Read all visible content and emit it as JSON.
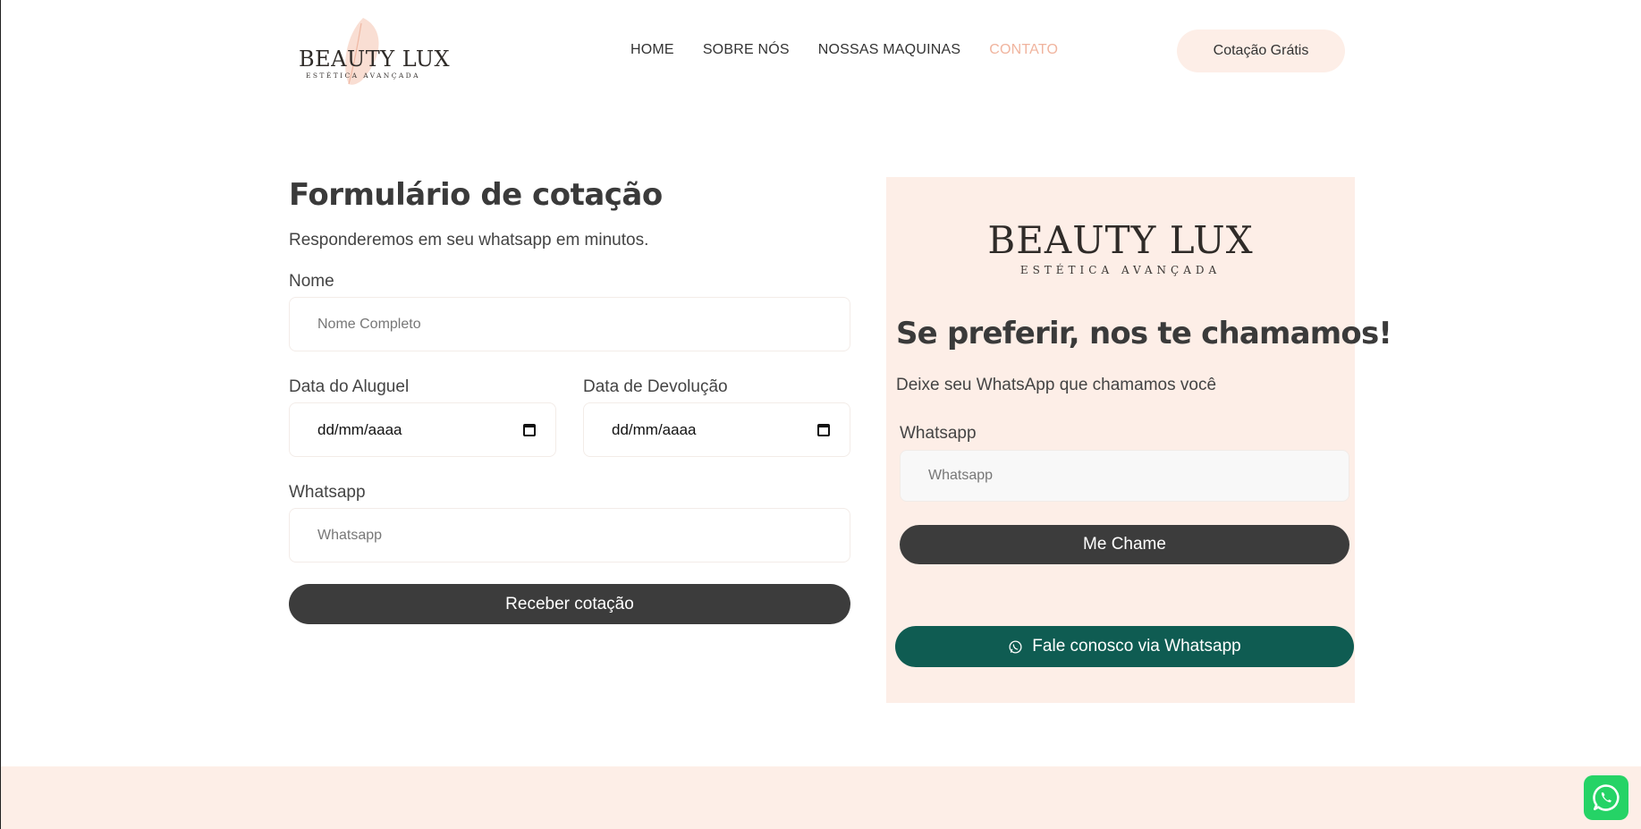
{
  "header": {
    "logo": {
      "brand": "BEAUTY LUX",
      "tagline": "ESTÉTICA AVANÇADA",
      "icon": "leaf-icon"
    },
    "nav": [
      {
        "label": "HOME",
        "active": false
      },
      {
        "label": "SOBRE NÓS",
        "active": false
      },
      {
        "label": "NOSSAS MAQUINAS",
        "active": false
      },
      {
        "label": "CONTATO",
        "active": true
      }
    ],
    "cta_label": "Cotação Grátis"
  },
  "quote_form": {
    "title": "Formulário de cotação",
    "subtitle": "Responderemos em seu whatsapp em minutos.",
    "name_label": "Nome",
    "name_placeholder": "Nome Completo",
    "rental_date_label": "Data do Aluguel",
    "rental_date_value": "dd/mm/aaaa",
    "return_date_label": "Data de Devolução",
    "return_date_value": "dd/mm/aaaa",
    "whatsapp_label": "Whatsapp",
    "whatsapp_placeholder": "Whatsapp",
    "submit_label": "Receber cotação"
  },
  "callback_panel": {
    "logo": {
      "brand": "BEAUTY LUX",
      "tagline": "ESTÉTICA AVANÇADA"
    },
    "title": "Se preferir, nos te chamamos!",
    "subtitle": "Deixe seu WhatsApp que chamamos você",
    "whatsapp_label": "Whatsapp",
    "whatsapp_placeholder": "Whatsapp",
    "call_button_label": "Me Chame",
    "whatsapp_button_label": "Fale conosco via Whatsapp"
  },
  "colors": {
    "accent_peach": "#fdeee7",
    "nav_active": "#f0b49e",
    "dark_button": "#3c3c3c",
    "whatsapp_green_dark": "#0f5c52",
    "whatsapp_green": "#25d366"
  },
  "floating": {
    "icon": "whatsapp-icon"
  }
}
